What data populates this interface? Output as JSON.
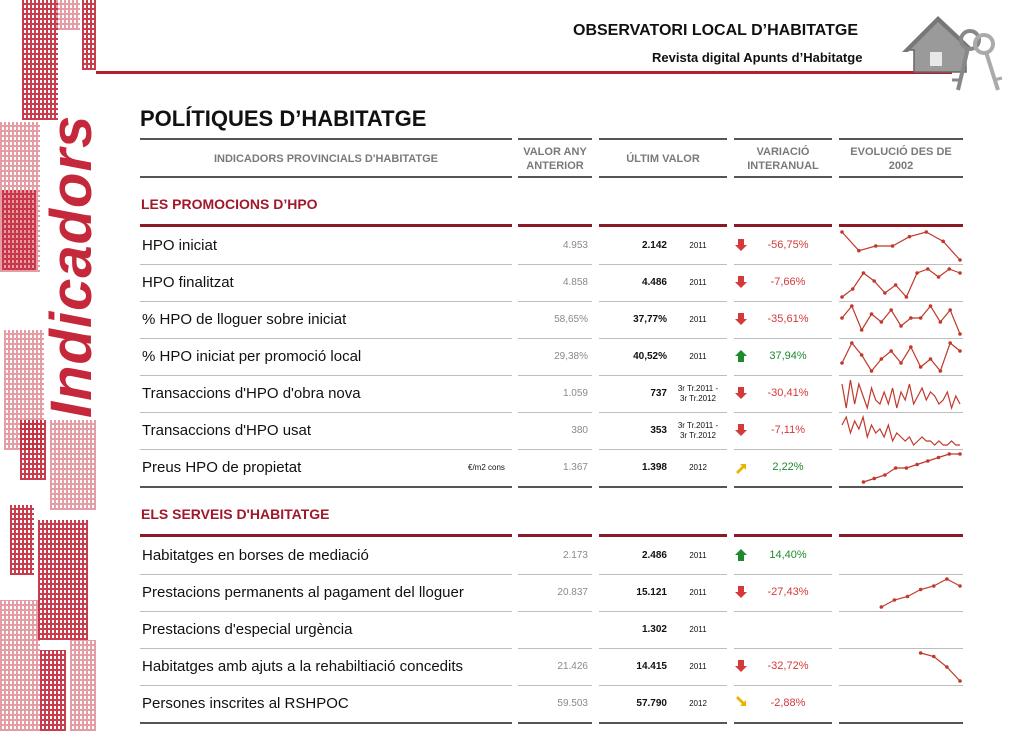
{
  "header": {
    "title": "OBSERVATORI LOCAL D’HABITATGE",
    "subtitle": "Revista digital Apunts d’Habitatge",
    "side_title": "Indicadors",
    "logo_icon": "house-keys-icon"
  },
  "page_title": "POLÍTIQUES D’HABITATGE",
  "columns": {
    "indicators": "INDICADORS PROVINCIALS D'HABITATGE",
    "prev_1": "VALOR ANY",
    "prev_2": "ANTERIOR",
    "last": "ÚLTIM VALOR",
    "var_1": "VARIACIÓ",
    "var_2": "INTERANUAL",
    "evo_1": "EVOLUCIÓ DES DE",
    "evo_2": "2002"
  },
  "sections": [
    {
      "title": "LES PROMOCIONS D’HPO",
      "rows": [
        {
          "label": "HPO iniciat",
          "unit": "",
          "prev": "4.953",
          "last": "2.142",
          "year": "2011",
          "year2": "",
          "dir": "down",
          "var": "-56,75%",
          "spark": [
            3,
            7,
            6,
            6,
            4,
            3,
            5,
            9
          ]
        },
        {
          "label": "HPO finalitzat",
          "unit": "",
          "prev": "4.858",
          "last": "4.486",
          "year": "2011",
          "year2": "",
          "dir": "down",
          "var": "-7,66%",
          "spark": [
            8,
            6,
            2,
            4,
            7,
            5,
            8,
            2,
            1,
            3,
            1,
            2
          ]
        },
        {
          "label": "% HPO de lloguer sobre iniciat",
          "unit": "",
          "prev": "58,65%",
          "last": "37,77%",
          "year": "2011",
          "year2": "",
          "dir": "down",
          "var": "-35,61%",
          "spark": [
            5,
            2,
            8,
            4,
            6,
            3,
            7,
            5,
            5,
            2,
            6,
            3,
            9
          ]
        },
        {
          "label": "% HPO iniciat per promoció local",
          "unit": "",
          "prev": "29,38%",
          "last": "40,52%",
          "year": "2011",
          "year2": "",
          "dir": "up",
          "var": "37,94%",
          "spark": [
            7,
            2,
            5,
            9,
            6,
            4,
            7,
            3,
            8,
            6,
            9,
            2,
            4
          ]
        },
        {
          "label": "Transaccions d'HPO d'obra nova",
          "unit": "",
          "prev": "1.059",
          "last": "737",
          "year": "3r Tr.2011 -",
          "year2": "3r Tr.2012",
          "dir": "down",
          "var": "-30,41%",
          "spark": [
            3,
            9,
            2,
            8,
            3,
            6,
            9,
            4,
            7,
            8,
            5,
            8,
            4,
            9,
            5,
            7,
            3,
            8,
            6,
            4,
            7,
            5,
            6,
            8,
            7,
            5,
            9,
            6,
            8
          ]
        },
        {
          "label": "Transaccions d'HPO usat",
          "unit": "",
          "prev": "380",
          "last": "353",
          "year": "3r Tr.2011 -",
          "year2": "3r Tr.2012",
          "dir": "down",
          "var": "-7,11%",
          "spark": [
            4,
            2,
            6,
            3,
            5,
            2,
            7,
            4,
            6,
            5,
            7,
            4,
            8,
            6,
            7,
            8,
            7,
            9,
            8,
            7,
            8,
            8,
            9,
            8,
            9,
            9,
            8,
            9,
            9
          ]
        },
        {
          "label": "Preus HPO de propietat",
          "unit": "€/m2 cons",
          "prev": "1.367",
          "last": "1.398",
          "year": "2012",
          "year2": "",
          "dir": "up-right",
          "var": "2,22%",
          "spark": [
            null,
            null,
            9,
            8,
            7,
            5,
            5,
            4,
            3,
            2,
            1,
            1
          ]
        }
      ]
    },
    {
      "title": "ELS SERVEIS D'HABITATGE",
      "rows": [
        {
          "label": "Habitatges en borses de mediació",
          "unit": "",
          "prev": "2.173",
          "last": "2.486",
          "year": "2011",
          "year2": "",
          "dir": "up",
          "var": "14,40%",
          "spark": []
        },
        {
          "label": "Prestacions permanents al pagament del lloguer",
          "unit": "",
          "prev": "20.837",
          "last": "15.121",
          "year": "2011",
          "year2": "",
          "dir": "down",
          "var": "-27,43%",
          "spark": [
            null,
            null,
            null,
            9,
            7,
            6,
            4,
            3,
            1,
            3
          ]
        },
        {
          "label": "Prestacions d'especial urgència",
          "unit": "",
          "prev": "",
          "last": "1.302",
          "year": "2011",
          "year2": "",
          "dir": "",
          "var": "",
          "spark": []
        },
        {
          "label": "Habitatges amb ajuts a la rehabiltiació concedits",
          "unit": "",
          "prev": "21.426",
          "last": "14.415",
          "year": "2011",
          "year2": "",
          "dir": "down",
          "var": "-32,72%",
          "spark": [
            null,
            null,
            null,
            null,
            null,
            null,
            1,
            2,
            5,
            9
          ]
        },
        {
          "label": "Persones inscrites al RSHPOC",
          "unit": "",
          "prev": "59.503",
          "last": "57.790",
          "year": "2012",
          "year2": "",
          "dir": "down-right",
          "var": "-2,88%",
          "spark": []
        }
      ]
    }
  ],
  "colors": {
    "accent": "#b21f2d",
    "negative": "#d43a3a",
    "positive": "#1e8a2e",
    "warning": "#e8b400",
    "spark": "#c0392b"
  }
}
